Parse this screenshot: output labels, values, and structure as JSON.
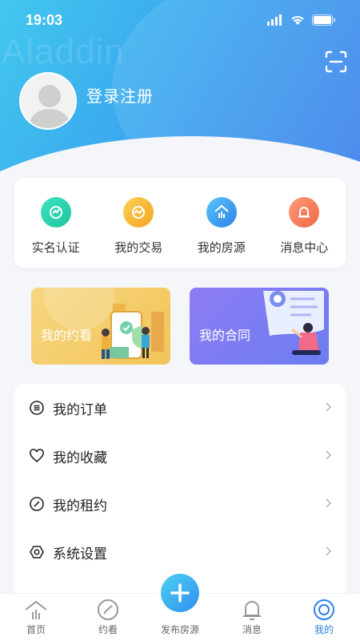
{
  "status_bar": {
    "time": "19:03"
  },
  "header": {
    "watermark": "Aladdin",
    "login_label": "登录注册"
  },
  "quick_links": [
    {
      "label": "实名认证",
      "icon": "verify-icon",
      "color": "#2ed3b0"
    },
    {
      "label": "我的交易",
      "icon": "trade-icon",
      "color": "#f5b52e"
    },
    {
      "label": "我的房源",
      "icon": "house-icon",
      "color": "#3a9bf0"
    },
    {
      "label": "消息中心",
      "icon": "bell-icon",
      "color": "#f47a5a"
    }
  ],
  "promo_cards": [
    {
      "label": "我的约看"
    },
    {
      "label": "我的合同"
    }
  ],
  "menu": [
    {
      "label": "我的订单",
      "icon": "list-icon"
    },
    {
      "label": "我的收藏",
      "icon": "heart-icon"
    },
    {
      "label": "我的租约",
      "icon": "clock-icon"
    },
    {
      "label": "系统设置",
      "icon": "settings-icon"
    }
  ],
  "tabbar": {
    "items": [
      {
        "label": "首页",
        "icon": "home-icon"
      },
      {
        "label": "约看",
        "icon": "compass-icon"
      },
      {
        "label": "发布房源",
        "icon": "plus-icon"
      },
      {
        "label": "消息",
        "icon": "bell-icon"
      },
      {
        "label": "我的",
        "icon": "profile-icon"
      }
    ],
    "active_index": 4
  },
  "colors": {
    "accent": "#2f80e8"
  }
}
